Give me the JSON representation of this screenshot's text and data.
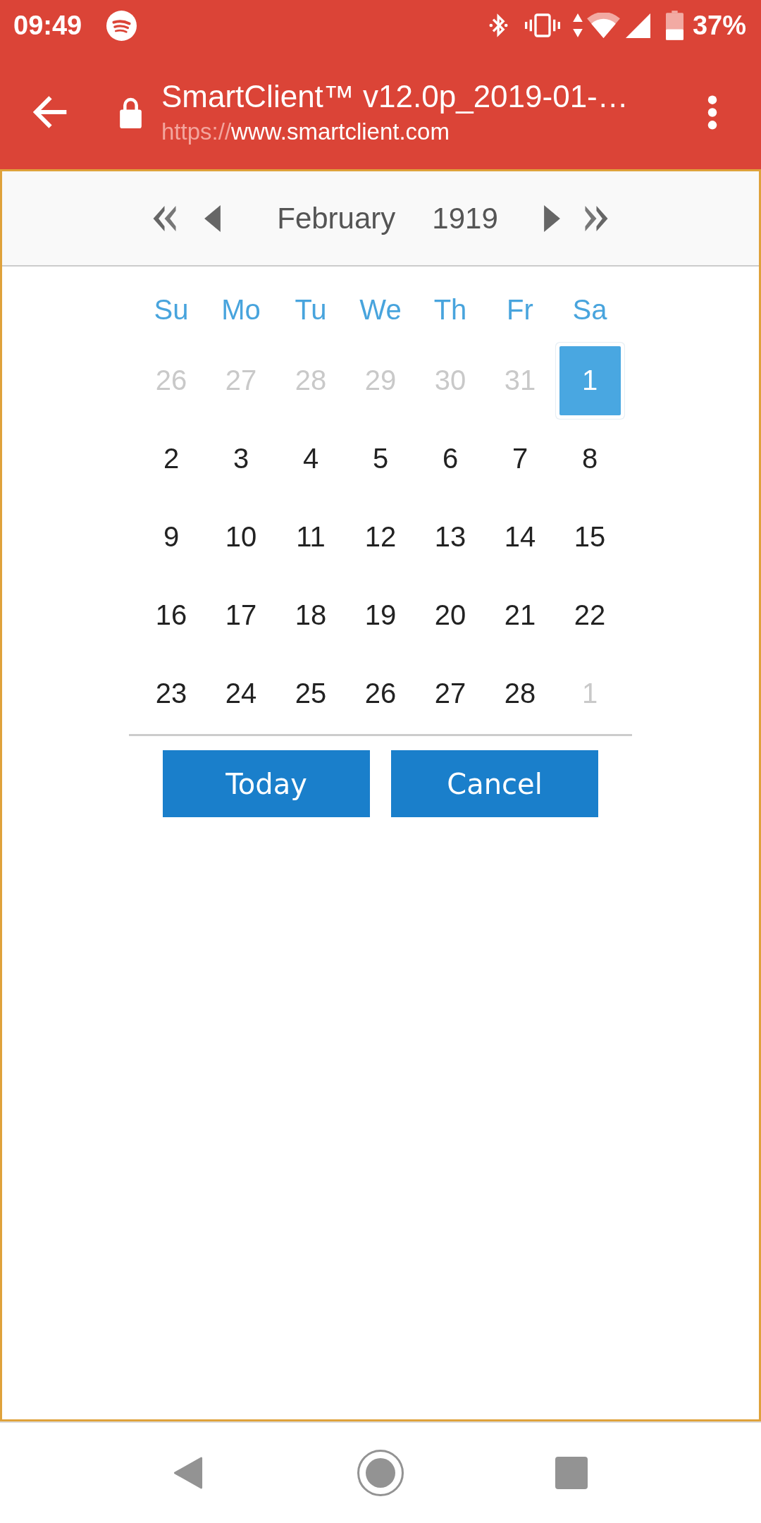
{
  "status_bar": {
    "time": "09:49",
    "battery_percent": "37%"
  },
  "toolbar": {
    "title": "SmartClient™ v12.0p_2019-01-…",
    "url_scheme": "https://",
    "url_host": "www.smartclient.com"
  },
  "calendar": {
    "month": "February",
    "year": "1919",
    "weekdays": [
      "Su",
      "Mo",
      "Tu",
      "We",
      "Th",
      "Fr",
      "Sa"
    ],
    "weeks": [
      [
        {
          "day": "26",
          "in_month": false,
          "selected": false
        },
        {
          "day": "27",
          "in_month": false,
          "selected": false
        },
        {
          "day": "28",
          "in_month": false,
          "selected": false
        },
        {
          "day": "29",
          "in_month": false,
          "selected": false
        },
        {
          "day": "30",
          "in_month": false,
          "selected": false
        },
        {
          "day": "31",
          "in_month": false,
          "selected": false
        },
        {
          "day": "1",
          "in_month": true,
          "selected": true
        }
      ],
      [
        {
          "day": "2",
          "in_month": true,
          "selected": false
        },
        {
          "day": "3",
          "in_month": true,
          "selected": false
        },
        {
          "day": "4",
          "in_month": true,
          "selected": false
        },
        {
          "day": "5",
          "in_month": true,
          "selected": false
        },
        {
          "day": "6",
          "in_month": true,
          "selected": false
        },
        {
          "day": "7",
          "in_month": true,
          "selected": false
        },
        {
          "day": "8",
          "in_month": true,
          "selected": false
        }
      ],
      [
        {
          "day": "9",
          "in_month": true,
          "selected": false
        },
        {
          "day": "10",
          "in_month": true,
          "selected": false
        },
        {
          "day": "11",
          "in_month": true,
          "selected": false
        },
        {
          "day": "12",
          "in_month": true,
          "selected": false
        },
        {
          "day": "13",
          "in_month": true,
          "selected": false
        },
        {
          "day": "14",
          "in_month": true,
          "selected": false
        },
        {
          "day": "15",
          "in_month": true,
          "selected": false
        }
      ],
      [
        {
          "day": "16",
          "in_month": true,
          "selected": false
        },
        {
          "day": "17",
          "in_month": true,
          "selected": false
        },
        {
          "day": "18",
          "in_month": true,
          "selected": false
        },
        {
          "day": "19",
          "in_month": true,
          "selected": false
        },
        {
          "day": "20",
          "in_month": true,
          "selected": false
        },
        {
          "day": "21",
          "in_month": true,
          "selected": false
        },
        {
          "day": "22",
          "in_month": true,
          "selected": false
        }
      ],
      [
        {
          "day": "23",
          "in_month": true,
          "selected": false
        },
        {
          "day": "24",
          "in_month": true,
          "selected": false
        },
        {
          "day": "25",
          "in_month": true,
          "selected": false
        },
        {
          "day": "26",
          "in_month": true,
          "selected": false
        },
        {
          "day": "27",
          "in_month": true,
          "selected": false
        },
        {
          "day": "28",
          "in_month": true,
          "selected": false
        },
        {
          "day": "1",
          "in_month": false,
          "selected": false
        }
      ]
    ],
    "buttons": [
      {
        "label": "Today"
      },
      {
        "label": "Cancel"
      }
    ]
  }
}
